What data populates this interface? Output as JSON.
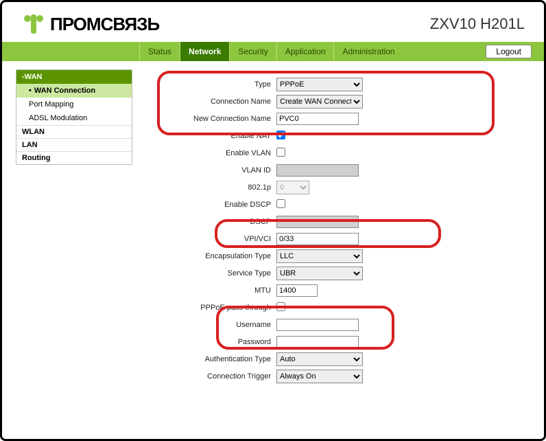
{
  "header": {
    "brand": "ПРОМСВЯЗЬ",
    "model": "ZXV10 H201L"
  },
  "tabs": {
    "status": "Status",
    "network": "Network",
    "security": "Security",
    "application": "Application",
    "administration": "Administration",
    "logout": "Logout"
  },
  "sidebar": {
    "wan": "-WAN",
    "wan_connection": "WAN Connection",
    "port_mapping": "Port Mapping",
    "adsl_modulation": "ADSL Modulation",
    "wlan": "WLAN",
    "lan": "LAN",
    "routing": "Routing"
  },
  "labels": {
    "type": "Type",
    "connection_name": "Connection Name",
    "new_connection_name": "New Connection Name",
    "enable_nat": "Enable NAT",
    "enable_vlan": "Enable VLAN",
    "vlan_id": "VLAN ID",
    "p8021": "802.1p",
    "enable_dscp": "Enable DSCP",
    "dscp": "DSCP",
    "vpi_vci": "VPI/VCI",
    "encapsulation_type": "Encapsulation Type",
    "service_type": "Service Type",
    "mtu": "MTU",
    "pppoe_pass": "PPPoE pass-through",
    "username": "Username",
    "password": "Password",
    "auth_type": "Authentication Type",
    "conn_trigger": "Connection Trigger"
  },
  "values": {
    "type": "PPPoE",
    "connection_name": "Create WAN Connection",
    "new_connection_name": "PVC0",
    "enable_nat": true,
    "enable_vlan": false,
    "vlan_id": "",
    "p8021": "0",
    "enable_dscp": false,
    "dscp": "",
    "vpi_vci": "0/33",
    "encapsulation_type": "LLC",
    "service_type": "UBR",
    "mtu": "1400",
    "pppoe_pass": false,
    "username": "",
    "password": "",
    "auth_type": "Auto",
    "conn_trigger": "Always On"
  }
}
